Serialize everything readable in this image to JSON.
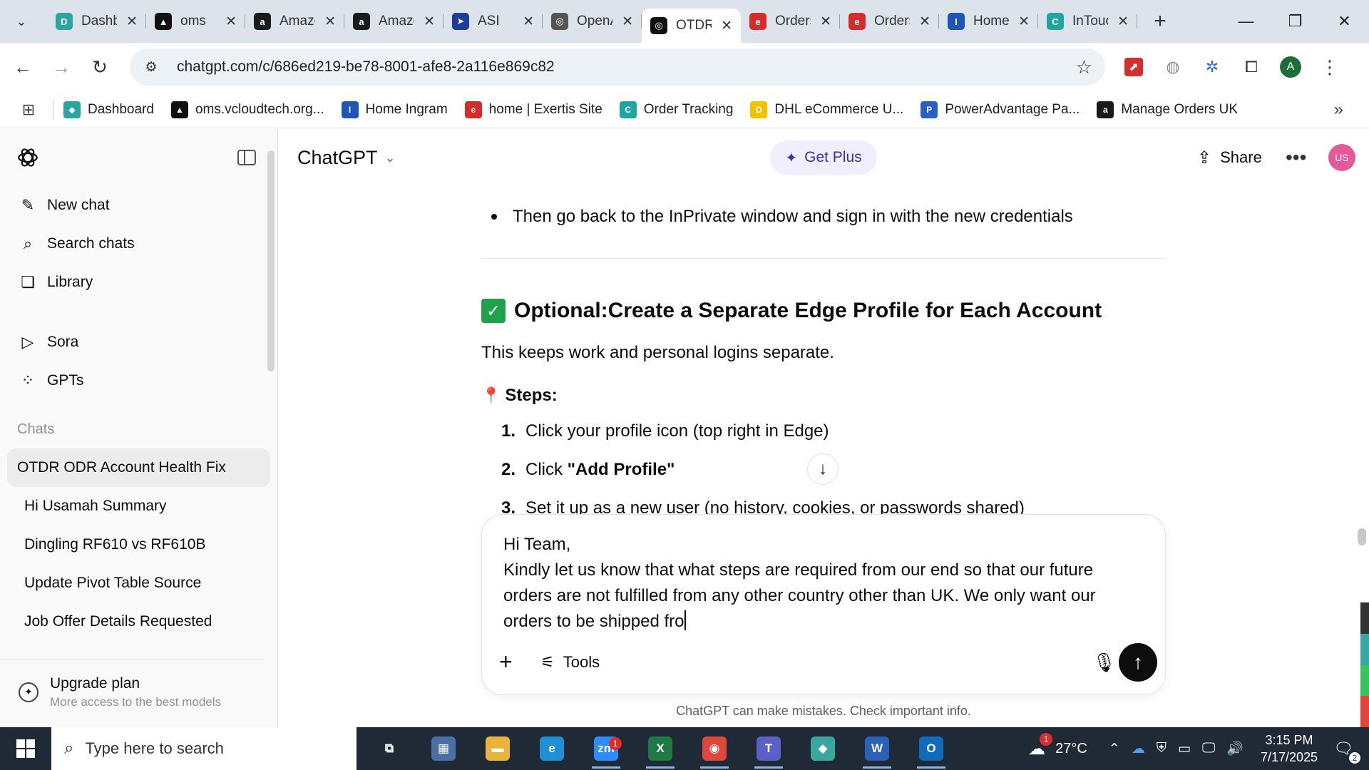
{
  "browser": {
    "tabs": [
      {
        "title": "Dashboard",
        "favicon": "D",
        "color": "#2aa5a0"
      },
      {
        "title": "oms",
        "favicon": "▲",
        "color": "#111111"
      },
      {
        "title": "Amazon",
        "favicon": "a",
        "color": "#1a1a1a"
      },
      {
        "title": "Amazon",
        "favicon": "a",
        "color": "#1a1a1a"
      },
      {
        "title": "ASI",
        "favicon": "➤",
        "color": "#1d3d9a"
      },
      {
        "title": "OpenAI",
        "favicon": "◎",
        "color": "#555555"
      },
      {
        "title": "OTDR",
        "favicon": "◎",
        "color": "#111111"
      },
      {
        "title": "Orders",
        "favicon": "e",
        "color": "#d62b2b"
      },
      {
        "title": "Orders",
        "favicon": "e",
        "color": "#d62b2b"
      },
      {
        "title": "Home",
        "favicon": "I",
        "color": "#1d56b8"
      },
      {
        "title": "InTouch",
        "favicon": "C",
        "color": "#20a6a0"
      }
    ],
    "active_tab_index": 6,
    "tab_close_glyph": "✕",
    "new_tab_glyph": "+",
    "window": {
      "minimize": "—",
      "restore": "❐",
      "close": "✕"
    },
    "url": "chatgpt.com/c/686ed219-be78-8001-afe8-2a116e869c82",
    "nav": {
      "back": "←",
      "forward": "→",
      "reload": "↻"
    },
    "profile_initial": "A",
    "bookmarks": [
      {
        "label": "Dashboard",
        "icon": "◆",
        "color": "#2aa5a0"
      },
      {
        "label": "oms.vcloudtech.org...",
        "icon": "▲",
        "color": "#111111"
      },
      {
        "label": "Home Ingram",
        "icon": "I",
        "color": "#1d56b8"
      },
      {
        "label": "home | Exertis Site",
        "icon": "e",
        "color": "#d62b2b"
      },
      {
        "label": "Order Tracking",
        "icon": "C",
        "color": "#20a6a0"
      },
      {
        "label": "DHL eCommerce U...",
        "icon": "D",
        "color": "#f2c200"
      },
      {
        "label": "PowerAdvantage Pa...",
        "icon": "P",
        "color": "#2b5fc8"
      },
      {
        "label": "Manage Orders UK",
        "icon": "a",
        "color": "#1a1a1a"
      }
    ],
    "bookmark_overflow": "»"
  },
  "sidebar": {
    "nav": [
      {
        "label": "New chat",
        "icon": "✎"
      },
      {
        "label": "Search chats",
        "icon": "⌕"
      },
      {
        "label": "Library",
        "icon": "❏"
      }
    ],
    "nav2": [
      {
        "label": "Sora",
        "icon": "▷"
      },
      {
        "label": "GPTs",
        "icon": "⁘"
      }
    ],
    "chats_heading": "Chats",
    "chats": [
      "OTDR ODR Account Health Fix",
      "Hi Usamah Summary",
      "Dingling RF610 vs RF610B",
      "Update Pivot Table Source",
      "Job Offer Details Requested"
    ],
    "active_chat_index": 0,
    "upgrade": {
      "title": "Upgrade plan",
      "subtitle": "More access to the best models"
    }
  },
  "header": {
    "model": "ChatGPT",
    "get_plus": "Get Plus",
    "share": "Share",
    "more": "•••",
    "user_initials": "US"
  },
  "message": {
    "bullet": "Then go back to the InPrivate window and sign in with the new credentials",
    "section_prefix": "Optional: ",
    "section_title": "Create a Separate Edge Profile for Each Account",
    "section_desc": "This keeps work and personal logins separate.",
    "steps_heading": "Steps:",
    "steps": [
      {
        "num": "1.",
        "text": "Click your profile icon (top right in Edge)"
      },
      {
        "num": "2.",
        "text_pre": "Click ",
        "text_bold": "\"Add Profile\""
      },
      {
        "num": "3.",
        "text": "Set it up as a new user (no history, cookies, or passwords shared)"
      }
    ]
  },
  "composer": {
    "text": "Hi Team,\nKindly let us know that what steps are required from our end so that our future orders are not fulfilled from any other country other than UK. We only want our orders to be shipped fro",
    "tools": "Tools"
  },
  "disclaimer": "ChatGPT can make mistakes. Check important info.",
  "taskbar": {
    "search_placeholder": "Type here to search",
    "apps": [
      {
        "name": "task-view",
        "glyph": "⧉",
        "color": "transparent",
        "running": false
      },
      {
        "name": "calculator",
        "glyph": "▦",
        "color": "#4a6fa5",
        "running": false
      },
      {
        "name": "file-explorer",
        "glyph": "▬",
        "color": "#e8b53a",
        "running": false
      },
      {
        "name": "edge",
        "glyph": "e",
        "color": "#1f8fd6",
        "running": false
      },
      {
        "name": "zoom",
        "glyph": "zm",
        "color": "#2d8cff",
        "running": true,
        "badge": "1"
      },
      {
        "name": "excel",
        "glyph": "X",
        "color": "#1d7a45",
        "running": true
      },
      {
        "name": "chrome",
        "glyph": "◉",
        "color": "#e0463a",
        "running": true
      },
      {
        "name": "teams",
        "glyph": "T",
        "color": "#5b5fc7",
        "running": true
      },
      {
        "name": "app",
        "glyph": "◆",
        "color": "#3aa6a0",
        "running": false
      },
      {
        "name": "word",
        "glyph": "W",
        "color": "#2b5fb8",
        "running": true
      },
      {
        "name": "outlook",
        "glyph": "O",
        "color": "#0f6cbd",
        "running": true
      }
    ],
    "weather": {
      "temp": "27°C",
      "badge": "1"
    },
    "clock": {
      "time": "3:15 PM",
      "date": "7/17/2025"
    },
    "notifications": "2"
  }
}
